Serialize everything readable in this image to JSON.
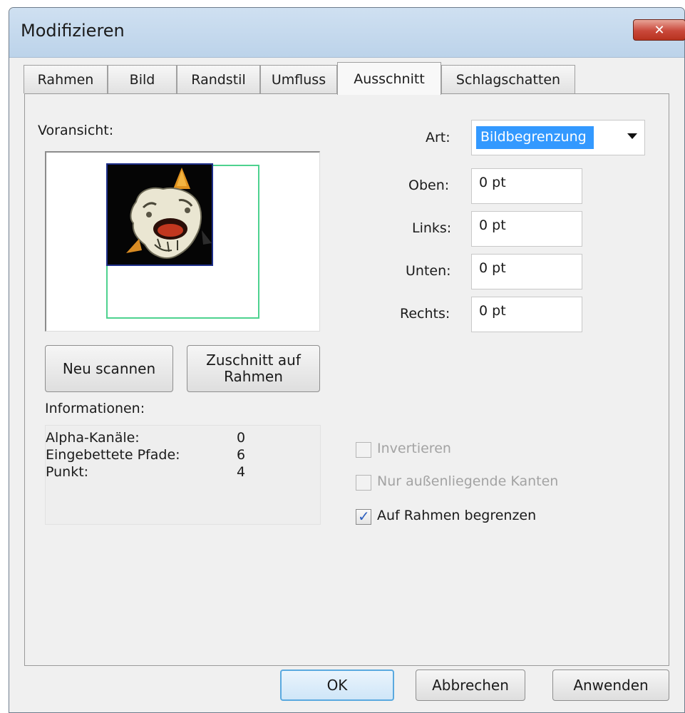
{
  "window": {
    "title": "Modifizieren",
    "close_icon": "close-icon"
  },
  "tabs": [
    {
      "label": "Rahmen",
      "active": false
    },
    {
      "label": "Bild",
      "active": false
    },
    {
      "label": "Randstil",
      "active": false
    },
    {
      "label": "Umfluss",
      "active": false
    },
    {
      "label": "Ausschnitt",
      "active": true
    },
    {
      "label": "Schlagschatten",
      "active": false
    }
  ],
  "preview": {
    "label": "Voransicht:"
  },
  "buttons": {
    "rescan": "Neu scannen",
    "crop_line1": "Zuschnitt auf",
    "crop_line2": "Rahmen"
  },
  "info": {
    "label": "Informationen:",
    "rows": [
      {
        "name": "Alpha-Kanäle:",
        "value": "0"
      },
      {
        "name": "Eingebettete Pfade:",
        "value": "6"
      },
      {
        "name": "Punkt:",
        "value": "4"
      }
    ]
  },
  "art": {
    "label": "Art:",
    "selected": "Bildbegrenzung"
  },
  "margins": [
    {
      "label": "Oben:",
      "value": "0 pt"
    },
    {
      "label": "Links:",
      "value": "0 pt"
    },
    {
      "label": "Unten:",
      "value": "0 pt"
    },
    {
      "label": "Rechts:",
      "value": "0 pt"
    }
  ],
  "checkboxes": [
    {
      "label": "Invertieren",
      "checked": false,
      "enabled": false
    },
    {
      "label": "Nur außenliegende Kanten",
      "checked": false,
      "enabled": false
    },
    {
      "label": "Auf Rahmen begrenzen",
      "checked": true,
      "enabled": true
    }
  ],
  "footer": {
    "ok": "OK",
    "cancel": "Abbrechen",
    "apply": "Anwenden"
  },
  "colors": {
    "selection": "#3399ff",
    "frame_outline": "#4ed28f",
    "image_border": "#1e2f8a"
  }
}
